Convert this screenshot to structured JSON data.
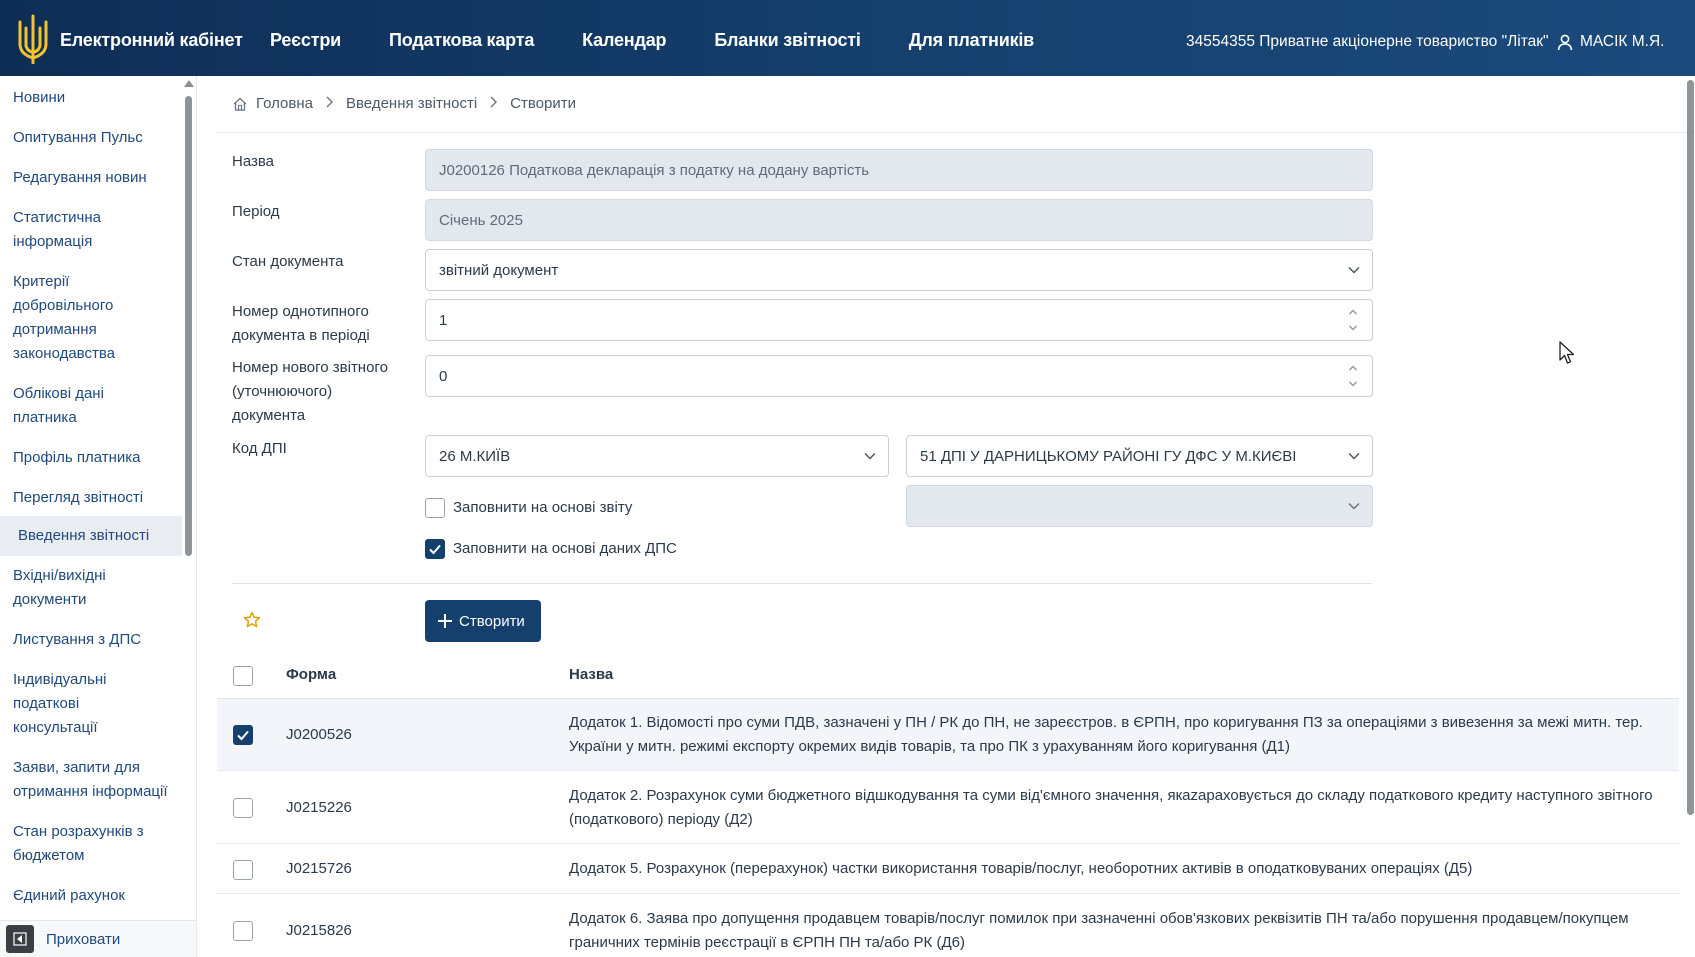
{
  "header": {
    "brand": "Електронний кабінет",
    "nav": [
      "Реєстри",
      "Податкова карта",
      "Календар",
      "Бланки звітності",
      "Для платників"
    ],
    "org": "34554355 Приватне акціонерне товариство \"Літак\"",
    "user": "МАСІК М.Я."
  },
  "sidebar": {
    "items": [
      "Новини",
      "Опитування Пульс",
      "Редагування новин",
      "Статистична інформація",
      "Критерії добровільного дотримання законодавства",
      "Облікові дані платника",
      "Профіль платника",
      "Перегляд звітності",
      "Введення звітності",
      "Вхідні/вихідні документи",
      "Листування з ДПС",
      "Індивідуальні податкові консультації",
      "Заяви, запити для отримання інформації",
      "Стан розрахунків з бюджетом",
      "Єдиний рахунок"
    ],
    "active": "Введення звітності",
    "hide_label": "Приховати"
  },
  "breadcrumb": [
    "Головна",
    "Введення звітності",
    "Створити"
  ],
  "form": {
    "name_label": "Назва",
    "name_value": "J0200126 Податкова декларація з податку на додану вартість",
    "period_label": "Період",
    "period_value": "Січень 2025",
    "state_label": "Стан документа",
    "state_value": "звітний документ",
    "num_label": "Номер однотипного документа в періоді",
    "num_value": "1",
    "newnum_label": "Номер нового звітного (уточнюючого) документа",
    "newnum_value": "0",
    "dpi_label": "Код ДПІ",
    "dpi_region": "26 М.КИЇВ",
    "dpi_office": "51 ДПІ У ДАРНИЦЬКОМУ РАЙОНІ ГУ ДФС У М.КИЄВІ",
    "fill_report_label": "Заповнити на основі звіту",
    "fill_report_checked": false,
    "fill_dps_label": "Заповнити на основі даних ДПС",
    "fill_dps_checked": true,
    "create_label": "Створити"
  },
  "table": {
    "headers": [
      "Форма",
      "Назва"
    ],
    "rows": [
      {
        "form": "J0200526",
        "name": "Додаток 1. Відомості про суми ПДВ, зазначені у ПН / РК до ПН, не зареєстров. в ЄРПН, про коригування ПЗ за операціями з вивезення за межі митн. тер. України у митн. режимі експорту окремих видів товарів, та про ПК з урахуванням його коригування (Д1)",
        "checked": true
      },
      {
        "form": "J0215226",
        "name": "Додаток 2. Розрахунок суми бюджетного відшкодування та суми від'ємного значення, якazараховується до складу податкового кредиту наступного звітного (податкового) періоду (Д2)",
        "checked": false
      },
      {
        "form": "J0215726",
        "name": "Додаток 5. Розрахунок (перерахунок) частки використання товарів/послуг, необоротних активів в оподатковуваних операціях (Д5)",
        "checked": false
      },
      {
        "form": "J0215826",
        "name": "Додаток 6. Заява про допущення продавцем товарів/послуг помилок при зазначенні обов'язкових реквізитів ПН та/або порушення продавцем/покупцем граничних термінів реєстрації в ЄРПН ПН та/або РК (Д6)",
        "checked": false
      }
    ]
  },
  "colors": {
    "header_dark": "#0e2d55",
    "primary": "#15406e",
    "link": "#1f4a7c",
    "disabled_bg": "#e3e8ef",
    "star": "#e0a400"
  }
}
